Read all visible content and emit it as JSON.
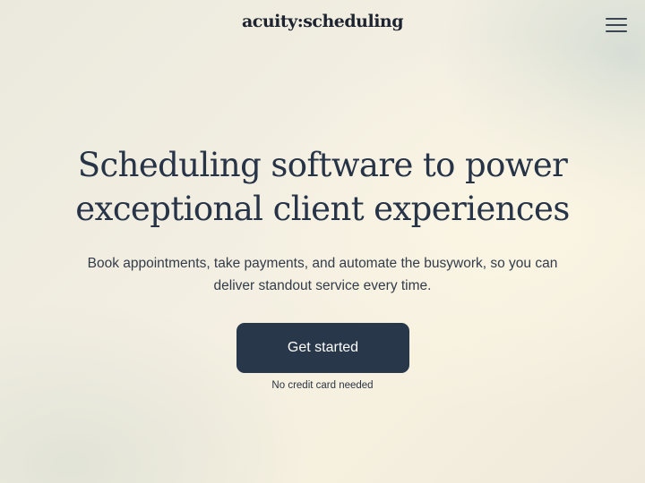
{
  "header": {
    "logo_text": "acuity:scheduling",
    "menu_icon": "hamburger-menu-icon"
  },
  "hero": {
    "headline": "Scheduling software to power exceptional client experiences",
    "subhead": "Book appointments, take payments, and automate the busywork, so you can deliver standout service every time.",
    "cta_label": "Get started",
    "cta_note": "No credit card needed"
  },
  "colors": {
    "text_dark": "#273447",
    "button_bg": "#283749",
    "button_text": "#ffffff",
    "background": "#f3efe2"
  }
}
